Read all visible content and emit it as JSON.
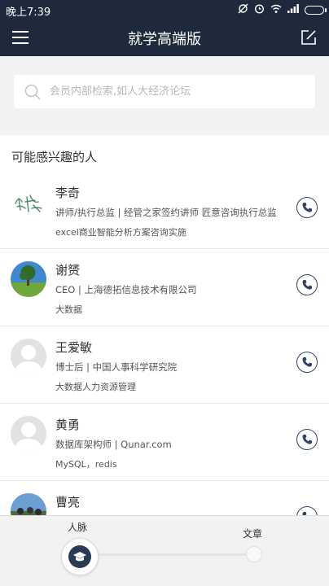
{
  "status_bar": {
    "time": "晚上7:39"
  },
  "header": {
    "title": "就学高端版"
  },
  "search": {
    "placeholder": "会员内部检索,如人大经济论坛"
  },
  "section": {
    "title": "可能感兴趣的人"
  },
  "people": [
    {
      "name": "李奇",
      "title": "讲师/执行总监 | 经管之家签约讲师 匠意咨询执行总监",
      "tags": "excel商业智能分析方案咨询实施"
    },
    {
      "name": "谢赟",
      "title": "CEO | 上海德拓信息技术有限公司",
      "tags": "大数据"
    },
    {
      "name": "王爱敏",
      "title": "博士后 | 中国人事科学研究院",
      "tags": "大数据人力资源管理"
    },
    {
      "name": "黄勇",
      "title": "数据库架构师 | Qunar.com",
      "tags": "MySQL，redis"
    },
    {
      "name": "曹亮",
      "title": "",
      "tags": ""
    }
  ],
  "bottom_nav": {
    "left_label": "人脉",
    "right_label": "文章"
  },
  "colors": {
    "header_bg": "#1e2a3c",
    "accent": "#2f4563",
    "background": "#f2f2f2"
  }
}
